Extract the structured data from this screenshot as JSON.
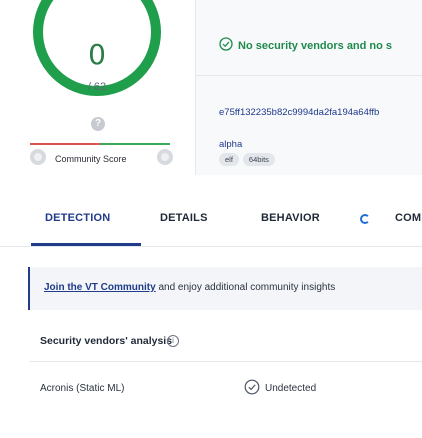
{
  "score": {
    "value": "0",
    "total": "/ 62",
    "color": "#1f9e4c"
  },
  "community": {
    "label": "Community Score"
  },
  "verdict": {
    "text": "No security vendors and no s",
    "icon": "check-circle-icon"
  },
  "file": {
    "hash": "e75ff132235b82c9994da2fa194a64ffb",
    "name": "alpha",
    "tags": [
      "elf",
      "64bits"
    ]
  },
  "tabs": [
    {
      "label": "DETECTION",
      "active": true
    },
    {
      "label": "DETAILS",
      "active": false
    },
    {
      "label": "BEHAVIOR",
      "active": false
    },
    {
      "label": "COMM",
      "active": false
    }
  ],
  "banner": {
    "link": "Join the VT Community",
    "text": " and enjoy additional community insights"
  },
  "vendors": {
    "title": "Security vendors' analysis",
    "rows": [
      {
        "name": "Acronis (Static ML)",
        "result": "Undetected"
      }
    ]
  },
  "colors": {
    "accent": "#1f3b8a",
    "success": "#1f8a4c"
  }
}
